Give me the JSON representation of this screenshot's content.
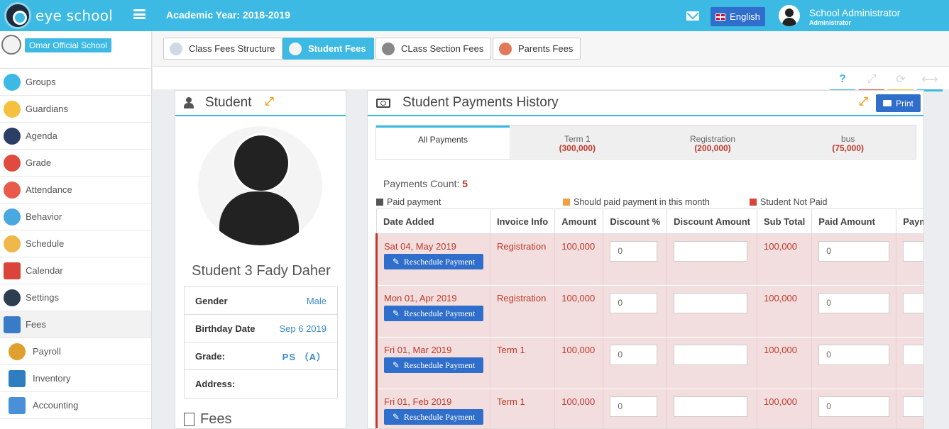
{
  "app": {
    "brand": "eye school",
    "academic_year": "Academic Year: 2018-2019",
    "language": "English"
  },
  "user": {
    "name": "School Administrator",
    "role": "Administrator"
  },
  "school": {
    "name": "Omar Official School"
  },
  "sidebar": {
    "items": [
      {
        "label": "Groups",
        "icon": "groups-icon",
        "color": "#3cbae4"
      },
      {
        "label": "Guardians",
        "icon": "guardians-icon",
        "color": "#f5c040"
      },
      {
        "label": "Agenda",
        "icon": "agenda-icon",
        "color": "#2c3e66"
      },
      {
        "label": "Grade",
        "icon": "grade-icon",
        "color": "#e04a3f"
      },
      {
        "label": "Attendance",
        "icon": "attendance-icon",
        "color": "#e85b4a"
      },
      {
        "label": "Behavior",
        "icon": "behavior-icon",
        "color": "#4aa8e0"
      },
      {
        "label": "Schedule",
        "icon": "schedule-icon",
        "color": "#f0b84a"
      },
      {
        "label": "Calendar",
        "icon": "calendar-icon",
        "color": "#d9453b"
      },
      {
        "label": "Settings",
        "icon": "settings-icon",
        "color": "#2d3e50"
      },
      {
        "label": "Fees",
        "icon": "fees-icon",
        "color": "#3a7bc8"
      },
      {
        "label": "Payroll",
        "icon": "payroll-icon",
        "color": "#e0a030"
      },
      {
        "label": "Inventory",
        "icon": "inventory-icon",
        "color": "#2f7fc0"
      },
      {
        "label": "Accounting",
        "icon": "accounting-icon",
        "color": "#4a90d9"
      }
    ]
  },
  "nav_tabs": [
    {
      "label": "Class Fees Structure",
      "active": false
    },
    {
      "label": "Student Fees",
      "active": true
    },
    {
      "label": "CLass Section Fees",
      "active": false
    },
    {
      "label": "Parents Fees",
      "active": false
    }
  ],
  "student": {
    "panel_title": "Student",
    "name": "Student 3 Fady Daher",
    "info": [
      {
        "label": "Gender",
        "value": "Male"
      },
      {
        "label": "Birthday Date",
        "value": "Sep 6 2019"
      },
      {
        "label": "Grade:",
        "value": "PS （A）"
      },
      {
        "label": "Address:",
        "value": ""
      }
    ],
    "fees_title": "Fees"
  },
  "history": {
    "title": "Student Payments History",
    "print_label": "Print",
    "tabs": [
      {
        "label": "All Payments",
        "amount": ""
      },
      {
        "label": "Term 1",
        "amount": "(300,000)"
      },
      {
        "label": "Registration",
        "amount": "(200,000)"
      },
      {
        "label": "bus",
        "amount": "(75,000)"
      }
    ],
    "count_label": "Payments Count:",
    "count_value": "5",
    "legend": [
      {
        "label": "Paid payment",
        "color": "#555555"
      },
      {
        "label": "Should paid payment in this month",
        "color": "#f0a040"
      },
      {
        "label": "Student Not Paid",
        "color": "#d9453b"
      }
    ],
    "columns": [
      "Date Added",
      "Invoice Info",
      "Amount",
      "Discount %",
      "Discount Amount",
      "Sub Total",
      "Paid Amount",
      "Payme"
    ],
    "reschedule_label": "Reschedule Payment",
    "rows": [
      {
        "date": "Sat 04, May 2019",
        "invoice": "Registration",
        "amount": "100,000",
        "discount_pct": "0",
        "discount_amount": "",
        "subtotal": "100,000",
        "paid": "0"
      },
      {
        "date": "Mon 01, Apr 2019",
        "invoice": "Registration",
        "amount": "100,000",
        "discount_pct": "0",
        "discount_amount": "",
        "subtotal": "100,000",
        "paid": "0"
      },
      {
        "date": "Fri 01, Mar 2019",
        "invoice": "Term 1",
        "amount": "100,000",
        "discount_pct": "0",
        "discount_amount": "",
        "subtotal": "100,000",
        "paid": "0"
      },
      {
        "date": "Fri 01, Feb 2019",
        "invoice": "Term 1",
        "amount": "100,000",
        "discount_pct": "0",
        "discount_amount": "",
        "subtotal": "100,000",
        "paid": "0"
      }
    ]
  },
  "colors": {
    "primary": "#3cbae4",
    "button": "#2f6ecb",
    "danger": "#c0392b",
    "row_bg": "#f2dede"
  }
}
